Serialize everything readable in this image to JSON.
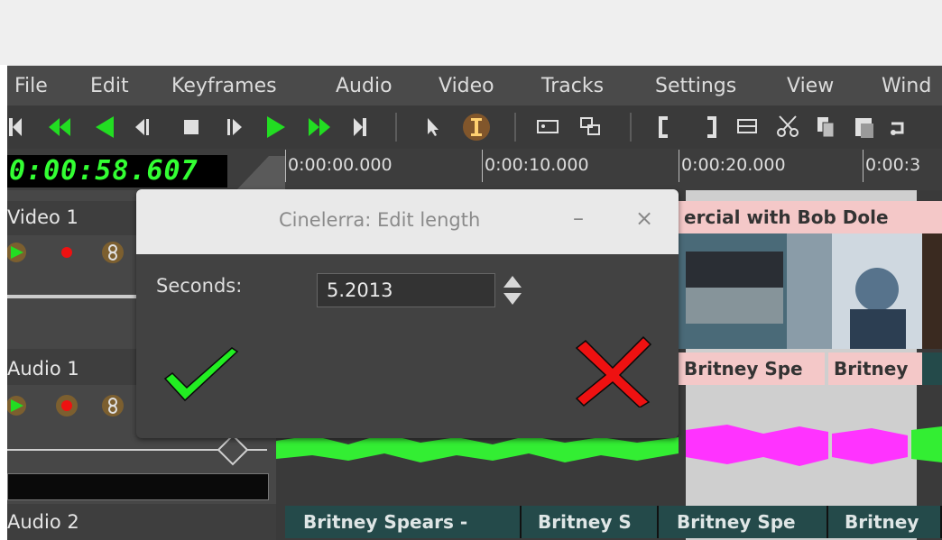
{
  "menubar": {
    "items": [
      "File",
      "Edit",
      "Keyframes",
      "Audio",
      "Video",
      "Tracks",
      "Settings",
      "View",
      "Wind"
    ]
  },
  "transport": {
    "clock": "0:00:58.607",
    "ruler": [
      "0:00:00.000",
      "0:00:10.000",
      "0:00:20.000",
      "0:00:3"
    ]
  },
  "tracks": {
    "video1": "Video 1",
    "audio1": "Audio 1",
    "audio2": "Audio 2"
  },
  "clips": {
    "video_title": "ercial with Bob Dole",
    "audio1_a": "Britney Spe",
    "audio1_b": "Britney",
    "audio2_a": "Britney Spears - ",
    "audio2_b": "Britney S",
    "audio2_c": "Britney Spe",
    "audio2_d": "Britney"
  },
  "dialog": {
    "title": "Cinelerra: Edit length",
    "minimize": "–",
    "close": "×",
    "seconds_label": "Seconds:",
    "seconds_value": "5.2013"
  },
  "colors": {
    "accent_green": "#33ee33",
    "cancel_red": "#ee1111",
    "clip_title_pink": "#f4c8c8",
    "audio_magenta": "#ff33ff"
  }
}
